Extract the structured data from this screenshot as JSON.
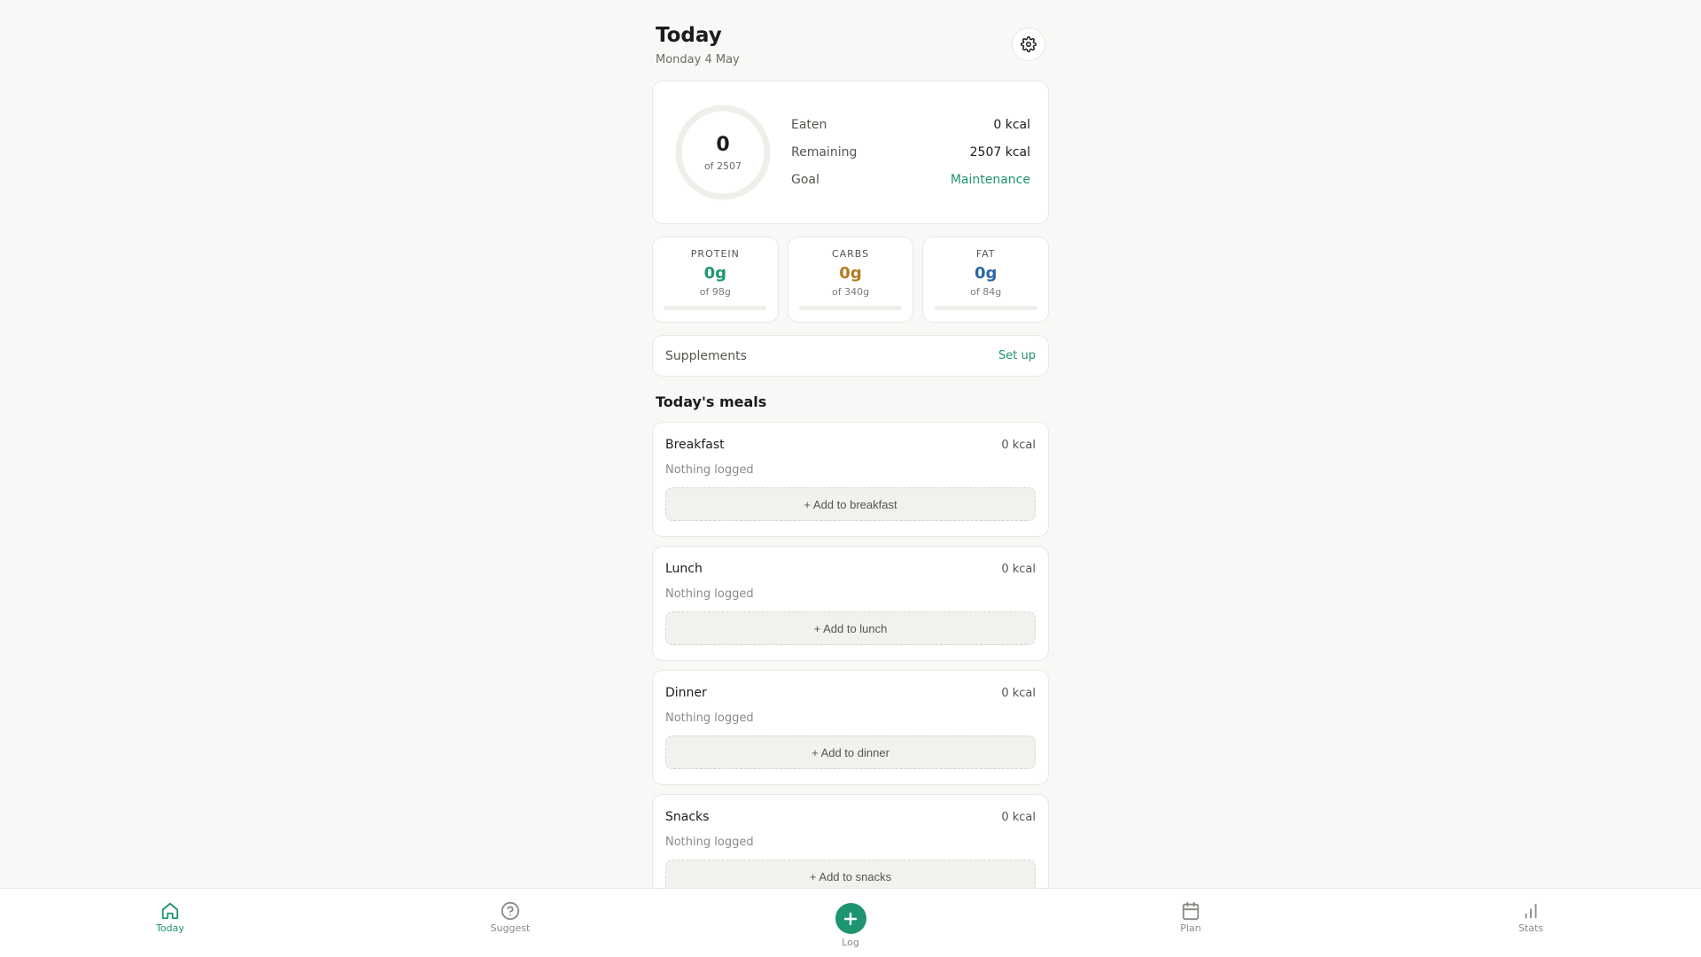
{
  "header": {
    "title": "Today",
    "date": "Monday 4 May",
    "settings_icon": "gear-icon"
  },
  "summary": {
    "calories_eaten": "0",
    "calories_of": "of 2507",
    "progress_fraction": 0,
    "rows": {
      "eaten_label": "Eaten",
      "eaten_value": "0 kcal",
      "remaining_label": "Remaining",
      "remaining_value": "2507 kcal",
      "goal_label": "Goal",
      "goal_value": "Maintenance"
    }
  },
  "macros": [
    {
      "label": "PROTEIN",
      "value": "0g",
      "target": "of 98g",
      "progress_fraction": 0,
      "color": "#1e9470"
    },
    {
      "label": "CARBS",
      "value": "0g",
      "target": "of 340g",
      "progress_fraction": 0,
      "color": "#b37a1f"
    },
    {
      "label": "FAT",
      "value": "0g",
      "target": "of 84g",
      "progress_fraction": 0,
      "color": "#2a66a8"
    }
  ],
  "supplements": {
    "label": "Supplements",
    "action": "Set up"
  },
  "meals_section": {
    "title": "Today's meals",
    "meals": [
      {
        "name": "Breakfast",
        "kcal": "0 kcal",
        "empty_text": "Nothing logged",
        "add_label": "+ Add to breakfast"
      },
      {
        "name": "Lunch",
        "kcal": "0 kcal",
        "empty_text": "Nothing logged",
        "add_label": "+ Add to lunch"
      },
      {
        "name": "Dinner",
        "kcal": "0 kcal",
        "empty_text": "Nothing logged",
        "add_label": "+ Add to dinner"
      },
      {
        "name": "Snacks",
        "kcal": "0 kcal",
        "empty_text": "Nothing logged",
        "add_label": "+ Add to snacks"
      }
    ]
  },
  "nav": {
    "active": "Today",
    "items": [
      {
        "label": "Today",
        "icon": "home-icon"
      },
      {
        "label": "Suggest",
        "icon": "help-circle-icon"
      },
      {
        "label": "Log",
        "icon": "plus-icon"
      },
      {
        "label": "Plan",
        "icon": "calendar-icon"
      },
      {
        "label": "Stats",
        "icon": "bar-chart-icon"
      }
    ]
  },
  "colors": {
    "accent": "#1e9470",
    "protein": "#1e9470",
    "carbs": "#b37a1f",
    "fat": "#2a66a8",
    "background": "#f8f8f6"
  }
}
